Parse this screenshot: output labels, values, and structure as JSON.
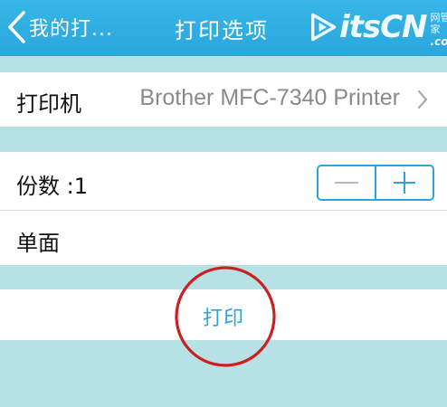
{
  "navbar": {
    "back_label": "我的打...",
    "title": "打印选项",
    "watermark": {
      "brand": "itsCN",
      "tagline": "网管之家",
      "domain": ".com"
    }
  },
  "printer": {
    "label": "打印机",
    "value": "Brother MFC-7340 Printer"
  },
  "copies": {
    "label": "份数 :1",
    "minus": "—",
    "plus": "+"
  },
  "sides": {
    "label": "单面"
  },
  "print_action": {
    "label": "打印"
  },
  "colors": {
    "accent": "#2aa6dc",
    "background": "#b6e2e6",
    "annotation": "#cc1f1f"
  },
  "icons": {
    "back": "chevron-left-icon",
    "disclosure": "chevron-right-icon",
    "minus": "minus-icon",
    "plus": "plus-icon",
    "logo": "bitscn-logo-icon"
  }
}
